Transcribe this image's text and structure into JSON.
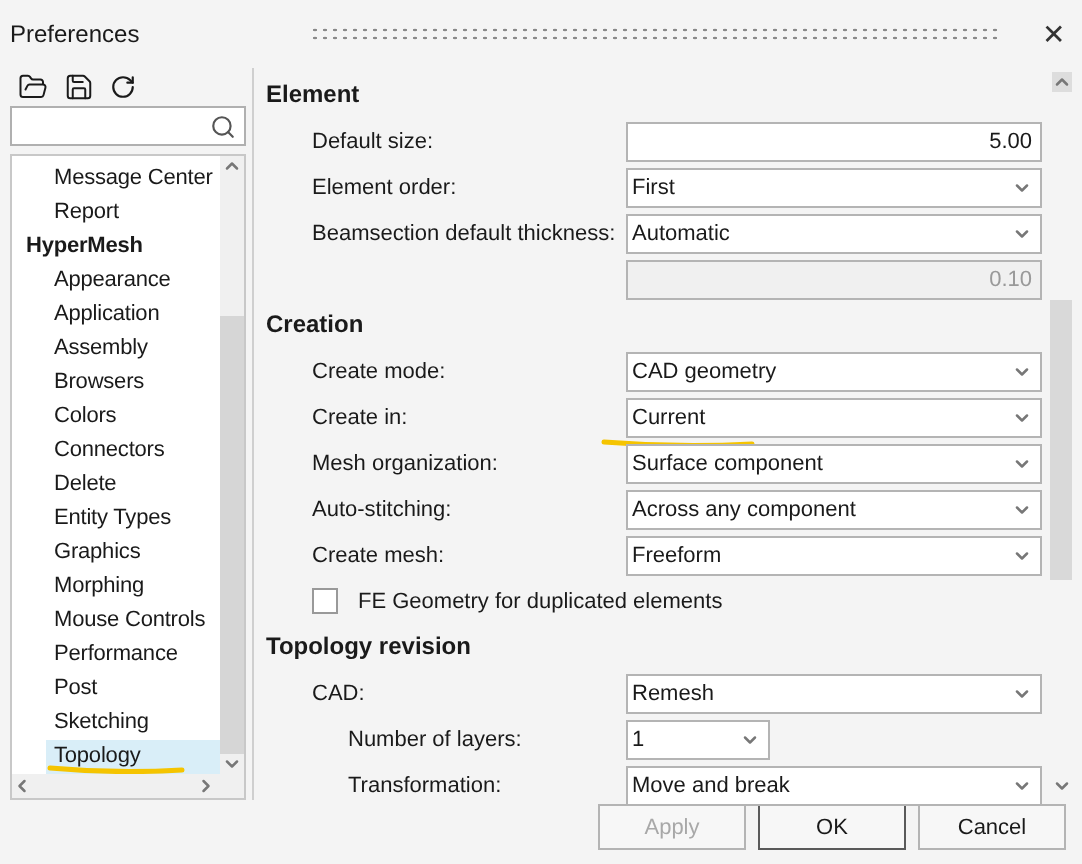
{
  "window": {
    "title": "Preferences",
    "close": "✕"
  },
  "sidebar": {
    "tree": [
      {
        "children": [
          {
            "label": "Message Center",
            "selected": false
          },
          {
            "label": "Report",
            "selected": false
          }
        ]
      },
      {
        "label": "HyperMesh",
        "selected": false,
        "children": [
          {
            "label": "Appearance",
            "selected": false
          },
          {
            "label": "Application",
            "selected": false
          },
          {
            "label": "Assembly",
            "selected": false
          },
          {
            "label": "Browsers",
            "selected": false
          },
          {
            "label": "Colors",
            "selected": false
          },
          {
            "label": "Connectors",
            "selected": false
          },
          {
            "label": "Delete",
            "selected": false
          },
          {
            "label": "Entity Types",
            "selected": false
          },
          {
            "label": "Graphics",
            "selected": false
          },
          {
            "label": "Morphing",
            "selected": false
          },
          {
            "label": "Mouse Controls",
            "selected": false
          },
          {
            "label": "Performance",
            "selected": false
          },
          {
            "label": "Post",
            "selected": false
          },
          {
            "label": "Sketching",
            "selected": false
          },
          {
            "label": "Topology",
            "selected": true,
            "underlined": true
          }
        ]
      }
    ]
  },
  "sections": [
    {
      "title": "Element",
      "rows": [
        {
          "kind": "input",
          "label": "Default size:",
          "value": "5.00",
          "disabled": false
        },
        {
          "kind": "select",
          "label": "Element order:",
          "value": "First"
        },
        {
          "kind": "select",
          "label": "Beamsection default thickness:",
          "value": "Automatic"
        },
        {
          "kind": "input",
          "value": "0.10",
          "disabled": true
        }
      ]
    },
    {
      "title": "Creation",
      "rows": [
        {
          "kind": "select",
          "label": "Create mode:",
          "value": "CAD geometry"
        },
        {
          "kind": "select",
          "label": "Create in:",
          "value": "Current",
          "underlined": true
        },
        {
          "kind": "select",
          "label": "Mesh organization:",
          "value": "Surface component"
        },
        {
          "kind": "select",
          "label": "Auto-stitching:",
          "value": "Across any component"
        },
        {
          "kind": "select",
          "label": "Create mesh:",
          "value": "Freeform"
        },
        {
          "kind": "checkbox",
          "label": "FE Geometry for duplicated elements",
          "checked": false
        }
      ]
    },
    {
      "title": "Topology revision",
      "rows": [
        {
          "kind": "select",
          "label": "CAD:",
          "value": "Remesh",
          "children": [
            {
              "kind": "small_select",
              "label": "Number of layers:",
              "value": "1"
            },
            {
              "kind": "select",
              "label": "Transformation:",
              "value": "Move and break"
            }
          ]
        }
      ]
    }
  ],
  "buttons": [
    {
      "label": "Apply",
      "disabled": true,
      "default": false
    },
    {
      "label": "OK",
      "disabled": false,
      "default": true
    },
    {
      "label": "Cancel",
      "disabled": false,
      "default": false
    }
  ]
}
